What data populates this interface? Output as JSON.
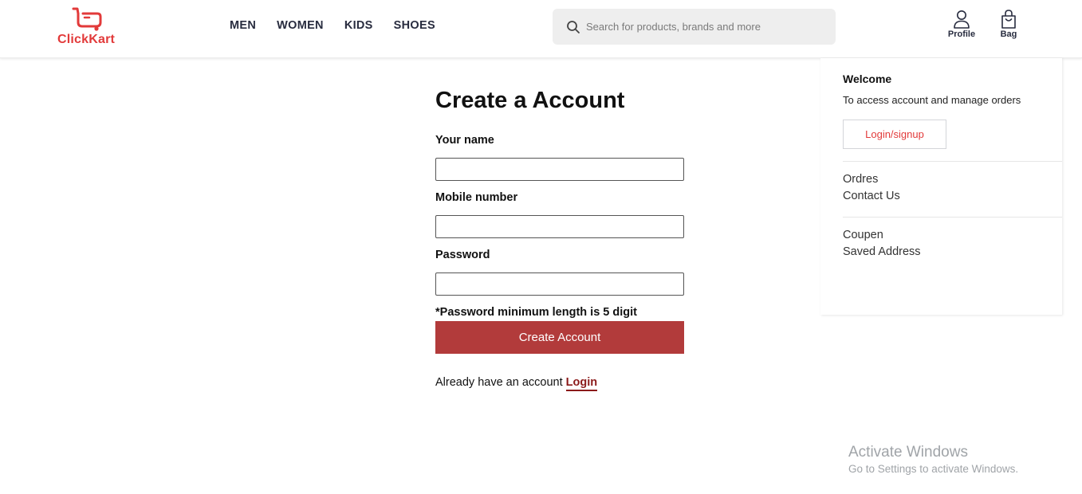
{
  "brand": {
    "name": "ClickKart",
    "color": "#e23a3a",
    "icon": "cart-icon"
  },
  "nav": {
    "items": [
      "MEN",
      "WOMEN",
      "KIDS",
      "SHOES"
    ]
  },
  "search": {
    "placeholder": "Search for products, brands and more",
    "icon": "search-icon"
  },
  "header_actions": {
    "profile": {
      "label": "Profile",
      "icon": "user-icon"
    },
    "bag": {
      "label": "Bag",
      "icon": "bag-icon"
    }
  },
  "profile_panel": {
    "title": "Welcome",
    "subtitle": "To access account and manage orders",
    "login_button": "Login/signup",
    "links_group1": [
      "Ordres",
      "Contact Us"
    ],
    "links_group2": [
      "Coupen",
      "Saved Address"
    ]
  },
  "form": {
    "title": "Create a Account",
    "name_label": "Your name",
    "name_value": "",
    "mobile_label": "Mobile number",
    "mobile_value": "",
    "password_label": "Password",
    "password_value": "",
    "password_note": "*Password minimum length is 5 digit",
    "submit_label": "Create Account",
    "submit_color": "#b23b3b",
    "already_text": "Already have an account",
    "login_link": "Login"
  },
  "watermark": {
    "title": "Activate Windows",
    "subtitle": "Go to Settings to activate Windows."
  }
}
